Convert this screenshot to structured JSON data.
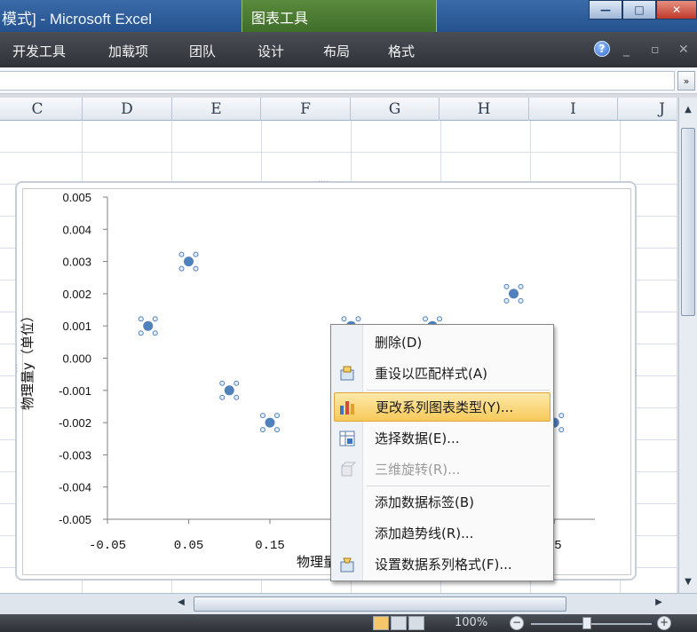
{
  "window": {
    "title": "模式] - Microsoft Excel",
    "contextual_tab": "图表工具",
    "buttons": {
      "minimize": "—",
      "maximize": "□",
      "close": "✕"
    }
  },
  "ribbon": {
    "tabs": [
      "开发工具",
      "加载项",
      "团队",
      "设计",
      "布局",
      "格式"
    ],
    "help": "?",
    "mini_controls": [
      "_",
      "▫",
      "✕"
    ]
  },
  "formula_bar": {
    "expand": "»"
  },
  "columns": [
    "C",
    "D",
    "E",
    "F",
    "G",
    "H",
    "I",
    "J"
  ],
  "chart": {
    "ylabel": "物理量y（单位）",
    "xlabel_visible": "物理量",
    "x_ticks": [
      "-0.05",
      "0.05",
      "0.15",
      ".5"
    ],
    "y_ticks": [
      "0.005",
      "0.004",
      "0.003",
      "0.002",
      "0.001",
      "0.000",
      "-0.001",
      "-0.002",
      "-0.003",
      "-0.004",
      "-0.005"
    ]
  },
  "chart_data": {
    "type": "scatter",
    "xlim": [
      -0.05,
      0.55
    ],
    "ylim": [
      -0.005,
      0.005
    ],
    "series": [
      {
        "x": [
          0.0,
          0.05,
          0.1,
          0.15,
          0.25,
          0.35,
          0.45,
          0.5
        ],
        "y": [
          0.001,
          0.003,
          -0.001,
          -0.002,
          0.001,
          0.001,
          0.002,
          -0.002
        ]
      }
    ],
    "grid": false,
    "marker_color": "#4f81bd"
  },
  "context_menu": {
    "items": [
      {
        "label": "删除(D)",
        "icon": "delete-icon"
      },
      {
        "label": "重设以匹配样式(A)",
        "icon": "reset-style-icon"
      },
      {
        "label": "更改系列图表类型(Y)...",
        "icon": "chart-type-icon"
      },
      {
        "label": "选择数据(E)...",
        "icon": "select-data-icon"
      },
      {
        "label": "三维旋转(R)...",
        "icon": "3d-rotation-icon"
      },
      {
        "label": "添加数据标签(B)",
        "icon": ""
      },
      {
        "label": "添加趋势线(R)...",
        "icon": ""
      },
      {
        "label": "设置数据系列格式(F)...",
        "icon": "format-series-icon"
      }
    ]
  },
  "status": {
    "zoom": "100%",
    "zoom_minus": "−",
    "zoom_plus": "+"
  },
  "colors": {
    "accent_green": "#4f7a34",
    "highlight": "#f7c95a",
    "marker": "#4f81bd"
  }
}
